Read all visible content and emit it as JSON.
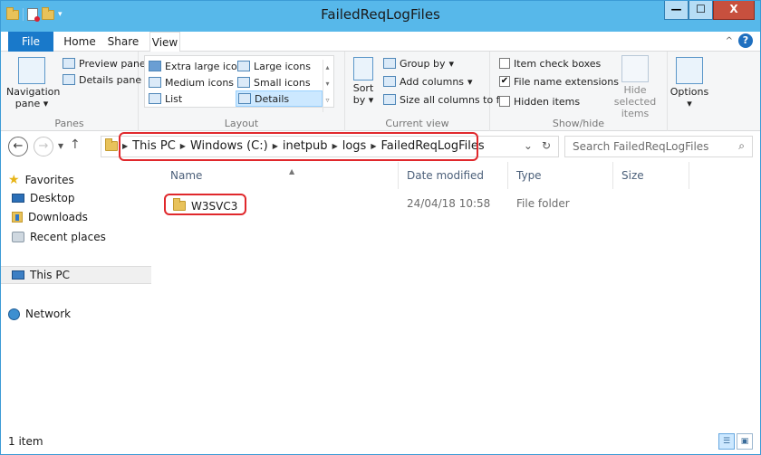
{
  "window": {
    "title": "FailedReqLogFiles"
  },
  "title_bar": {
    "minimize": "—",
    "maximize": "☐",
    "close": "X"
  },
  "ribbon_tabs": {
    "file": "File",
    "home": "Home",
    "share": "Share",
    "view": "View"
  },
  "ribbon": {
    "panes": {
      "navigation_pane": "Navigation pane",
      "preview_pane": "Preview pane",
      "details_pane": "Details pane",
      "label": "Panes"
    },
    "layout": {
      "extra_large_icons": "Extra large icons",
      "large_icons": "Large icons",
      "medium_icons": "Medium icons",
      "small_icons": "Small icons",
      "list": "List",
      "details": "Details",
      "label": "Layout"
    },
    "current_view": {
      "sort_by": "Sort by",
      "group_by": "Group by",
      "add_columns": "Add columns",
      "size_all_columns": "Size all columns to fit",
      "label": "Current view"
    },
    "show_hide": {
      "item_check_boxes": "Item check boxes",
      "file_name_extensions": "File name extensions",
      "hidden_items": "Hidden items",
      "hide_selected_items": "Hide selected items",
      "label": "Show/hide",
      "item_check_boxes_checked": false,
      "file_name_extensions_checked": true,
      "hidden_items_checked": false
    },
    "options": {
      "label": "Options"
    }
  },
  "address": {
    "crumbs": [
      "This PC",
      "Windows (C:)",
      "inetpub",
      "logs",
      "FailedReqLogFiles"
    ]
  },
  "search": {
    "placeholder": "Search FailedReqLogFiles"
  },
  "nav_pane": {
    "favorites": "Favorites",
    "desktop": "Desktop",
    "downloads": "Downloads",
    "recent_places": "Recent places",
    "this_pc": "This PC",
    "network": "Network"
  },
  "columns": {
    "name": "Name",
    "date_modified": "Date modified",
    "type": "Type",
    "size": "Size"
  },
  "files": [
    {
      "name": "W3SVC3",
      "date_modified": "24/04/18 10:58",
      "type": "File folder",
      "size": ""
    }
  ],
  "status": {
    "item_count": "1 item"
  },
  "colors": {
    "titlebar": "#57b8ea",
    "file_tab": "#1979ca",
    "highlight": "#e0282c"
  }
}
